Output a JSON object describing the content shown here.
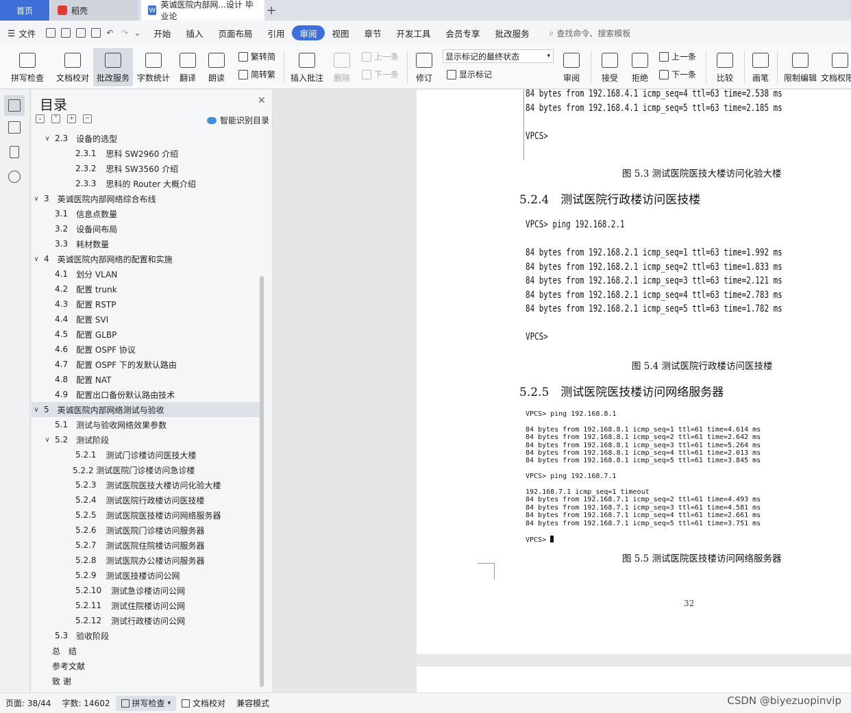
{
  "tabs": {
    "home": "首页",
    "wps": "稻壳",
    "doc": "英诚医院内部网...设计 毕业论",
    "add": "+"
  },
  "menu": {
    "file": "文件",
    "items": [
      "开始",
      "插入",
      "页面布局",
      "引用",
      "审阅",
      "视图",
      "章节",
      "开发工具",
      "会员专享",
      "批改服务"
    ],
    "active": "审阅",
    "search": "查找命令、搜索模板"
  },
  "ribbon": {
    "spellcheck": "拼写检查",
    "doc_proof": "文档校对",
    "review_service": "批改服务",
    "word_count": "字数统计",
    "translate": "翻译",
    "read_aloud": "朗读",
    "to_traditional": "繁转简",
    "to_simplified": "简转繁",
    "insert_comment": "插入批注",
    "delete": "删除",
    "prev_comment": "上一条",
    "next_comment": "下一条",
    "track": "修订",
    "markup_dropdown": "显示标记的最终状态",
    "show_markup": "显示标记",
    "review_pane": "审阅",
    "accept": "接受",
    "reject": "拒绝",
    "prev": "上一条",
    "next": "下一条",
    "compare": "比较",
    "ink": "画笔",
    "restrict": "限制编辑",
    "doc_permission": "文档权限"
  },
  "toc": {
    "title": "目录",
    "smart": "智能识别目录",
    "items": [
      {
        "num": "2.3",
        "text": "设备的选型",
        "level": 2,
        "chev": true
      },
      {
        "num": "2.3.1",
        "text": "思科 SW2960 介绍",
        "level": 3
      },
      {
        "num": "2.3.2",
        "text": "思科 SW3560 介绍",
        "level": 3
      },
      {
        "num": "2.3.3",
        "text": "思科的 Router 大概介绍",
        "level": 3
      },
      {
        "num": "3",
        "text": "英诚医院内部网络综合布线",
        "level": 1,
        "chev": true
      },
      {
        "num": "3.1",
        "text": "信息点数量",
        "level": 2
      },
      {
        "num": "3.2",
        "text": "设备间布局",
        "level": 2
      },
      {
        "num": "3.3",
        "text": "耗材数量",
        "level": 2
      },
      {
        "num": "4",
        "text": "英诚医院内部网络的配置和实施",
        "level": 1,
        "chev": true
      },
      {
        "num": "4.1",
        "text": "划分 VLAN",
        "level": 2
      },
      {
        "num": "4.2",
        "text": "配置 trunk",
        "level": 2
      },
      {
        "num": "4.3",
        "text": "配置 RSTP",
        "level": 2
      },
      {
        "num": "4.4",
        "text": "配置 SVI",
        "level": 2
      },
      {
        "num": "4.5",
        "text": "配置 GLBP",
        "level": 2
      },
      {
        "num": "4.6",
        "text": "配置 OSPF 协议",
        "level": 2
      },
      {
        "num": "4.7",
        "text": "配置 OSPF 下的发默认路由",
        "level": 2
      },
      {
        "num": "4.8",
        "text": "配置 NAT",
        "level": 2
      },
      {
        "num": "4.9",
        "text": "配置出口备份默认路由技术",
        "level": 2
      },
      {
        "num": "5",
        "text": "英诚医院内部网络测试与验收",
        "level": 1,
        "chev": true,
        "selected": true
      },
      {
        "num": "5.1",
        "text": "测试与验收网络效果参数",
        "level": 2
      },
      {
        "num": "5.2",
        "text": "测试阶段",
        "level": 2,
        "chev": true
      },
      {
        "num": "5.2.1",
        "text": "测试门诊楼访问医技大楼",
        "level": 3
      },
      {
        "num": "",
        "text": "5.2.2 测试医院门诊楼访问急诊楼",
        "level": 3
      },
      {
        "num": "5.2.3",
        "text": "测试医院医技大楼访问化验大楼",
        "level": 3
      },
      {
        "num": "5.2.4",
        "text": "测试医院行政楼访问医技楼",
        "level": 3
      },
      {
        "num": "5.2.5",
        "text": "测试医院医技楼访问网络服务器",
        "level": 3
      },
      {
        "num": "5.2.6",
        "text": "测试医院门诊楼访问服务器",
        "level": 3
      },
      {
        "num": "5.2.7",
        "text": "测试医院住院楼访问服务器",
        "level": 3
      },
      {
        "num": "5.2.8",
        "text": "测试医院办公楼访问服务器",
        "level": 3
      },
      {
        "num": "5.2.9",
        "text": "测试医技楼访问公网",
        "level": 3
      },
      {
        "num": "5.2.10",
        "text": "测试急诊楼访问公网",
        "level": 3
      },
      {
        "num": "5.2.11",
        "text": "测试住院楼访问公网",
        "level": 3
      },
      {
        "num": "5.2.12",
        "text": "测试行政楼访问公网",
        "level": 3
      },
      {
        "num": "5.3",
        "text": "验收阶段",
        "level": 2
      },
      {
        "num": "",
        "text": "总　结",
        "level": 1
      },
      {
        "num": "",
        "text": "参考文献",
        "level": 1
      },
      {
        "num": "",
        "text": "致 谢",
        "level": 1
      }
    ]
  },
  "document": {
    "top_cli": "84 bytes from 192.168.4.1 icmp_seq=4 ttl=63 time=2.538 ms\n84 bytes from 192.168.4.1 icmp_seq=5 ttl=63 time=2.185 ms\n\nVPCS>",
    "caption_53": "图 5.3 测试医院医技大楼访问化验大楼",
    "heading_524": "5.2.4　测试医院行政楼访问医技楼",
    "cli_524": "VPCS> ping 192.168.2.1\n\n84 bytes from 192.168.2.1 icmp_seq=1 ttl=63 time=1.992 ms\n84 bytes from 192.168.2.1 icmp_seq=2 ttl=63 time=1.833 ms\n84 bytes from 192.168.2.1 icmp_seq=3 ttl=63 time=2.121 ms\n84 bytes from 192.168.2.1 icmp_seq=4 ttl=63 time=2.783 ms\n84 bytes from 192.168.2.1 icmp_seq=5 ttl=63 time=1.782 ms\n\nVPCS>",
    "caption_54": "图 5.4 测试医院行政楼访问医技楼",
    "heading_525": "5.2.5　测试医院医技楼访问网络服务器",
    "cli_525": "VPCS> ping 192.168.8.1\n\n84 bytes from 192.168.8.1 icmp_seq=1 ttl=61 time=4.614 ms\n84 bytes from 192.168.8.1 icmp_seq=2 ttl=61 time=2.642 ms\n84 bytes from 192.168.8.1 icmp_seq=3 ttl=61 time=5.264 ms\n84 bytes from 192.168.8.1 icmp_seq=4 ttl=61 time=2.013 ms\n84 bytes from 192.168.8.1 icmp_seq=5 ttl=61 time=3.845 ms\n\nVPCS> ping 192.168.7.1\n\n192.168.7.1 icmp_seq=1 timeout\n84 bytes from 192.168.7.1 icmp_seq=2 ttl=61 time=4.493 ms\n84 bytes from 192.168.7.1 icmp_seq=3 ttl=61 time=4.581 ms\n84 bytes from 192.168.7.1 icmp_seq=4 ttl=61 time=2.661 ms\n84 bytes from 192.168.7.1 icmp_seq=5 ttl=61 time=3.751 ms\n\nVPCS> ",
    "caption_55": "图 5.5 测试医院医技楼访问网络服务器",
    "page_number": "32"
  },
  "status": {
    "page": "页面: 38/44",
    "words": "字数: 14602",
    "spellcheck": "拼写检查",
    "doc_proof": "文档校对",
    "compat": "兼容模式"
  },
  "watermark": "CSDN @biyezuopinvip"
}
